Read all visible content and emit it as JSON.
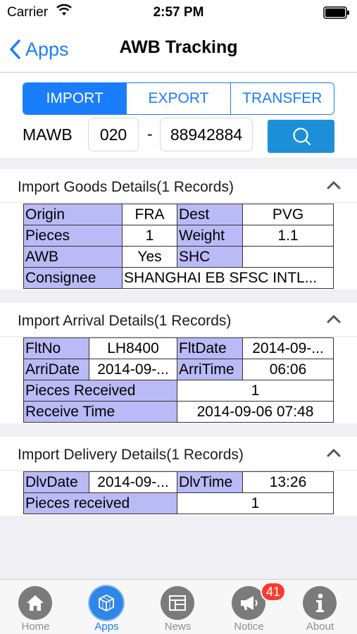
{
  "status": {
    "carrier": "Carrier",
    "time": "2:57 PM"
  },
  "nav": {
    "back_label": "Apps",
    "title": "AWB Tracking"
  },
  "segments": [
    {
      "label": "IMPORT",
      "active": true
    },
    {
      "label": "EXPORT",
      "active": false
    },
    {
      "label": "TRANSFER",
      "active": false
    }
  ],
  "search": {
    "mawb_label": "MAWB",
    "prefix_value": "020",
    "separator": "-",
    "number_value": "88942884"
  },
  "goods": {
    "title": "Import Goods Details(1 Records)",
    "origin_label": "Origin",
    "origin": "FRA",
    "dest_label": "Dest",
    "dest": "PVG",
    "pieces_label": "Pieces",
    "pieces": "1",
    "weight_label": "Weight",
    "weight": "1.1",
    "awb_label": "AWB",
    "awb": "Yes",
    "shc_label": "SHC",
    "shc": "",
    "consignee_label": "Consignee",
    "consignee": "SHANGHAI EB SFSC INTL..."
  },
  "arrival": {
    "title": "Import Arrival Details(1 Records)",
    "fltno_label": "FltNo",
    "fltno": "LH8400",
    "fltdate_label": "FltDate",
    "fltdate": "2014-09-...",
    "arridate_label": "ArriDate",
    "arridate": "2014-09-...",
    "arritime_label": "ArriTime",
    "arritime": "06:06",
    "pieces_received_label": "Pieces Received",
    "pieces_received": "1",
    "receive_time_label": "Receive Time",
    "receive_time": "2014-09-06 07:48"
  },
  "delivery": {
    "title": "Import Delivery Details(1 Records)",
    "dlvdate_label": "DlvDate",
    "dlvdate": "2014-09-...",
    "dlvtime_label": "DlvTime",
    "dlvtime": "13:26",
    "pieces_received_label": "Pieces received",
    "pieces_received": "1"
  },
  "tabs": [
    {
      "label": "Home",
      "icon": "home-icon"
    },
    {
      "label": "Apps",
      "icon": "apps-icon",
      "active": true
    },
    {
      "label": "News",
      "icon": "news-icon"
    },
    {
      "label": "Notice",
      "icon": "megaphone-icon",
      "badge": "41"
    },
    {
      "label": "About",
      "icon": "info-icon"
    }
  ],
  "colors": {
    "accent": "#1a7dfb",
    "label_cell": "#babaf6",
    "search_button": "#1d8fd9",
    "badge": "#ff3b30"
  }
}
